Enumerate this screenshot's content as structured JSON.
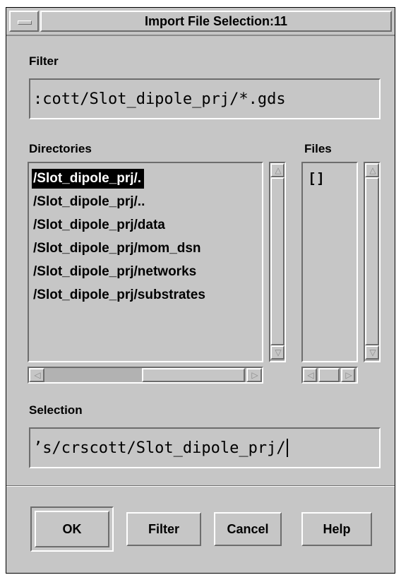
{
  "window": {
    "title": "Import File Selection:11"
  },
  "filter": {
    "label": "Filter",
    "value": ":cott/Slot_dipole_prj/*.gds"
  },
  "directories": {
    "label": "Directories",
    "items": [
      {
        "text": "/Slot_dipole_prj/.",
        "selected": true
      },
      {
        "text": "/Slot_dipole_prj/..",
        "selected": false
      },
      {
        "text": "/Slot_dipole_prj/data",
        "selected": false
      },
      {
        "text": "/Slot_dipole_prj/mom_dsn",
        "selected": false
      },
      {
        "text": "/Slot_dipole_prj/networks",
        "selected": false
      },
      {
        "text": "/Slot_dipole_prj/substrates",
        "selected": false
      }
    ]
  },
  "files": {
    "label": "Files",
    "items": [
      {
        "text": "[ ]"
      }
    ]
  },
  "selection": {
    "label": "Selection",
    "value": "’s/crscott/Slot_dipole_prj/"
  },
  "buttons": {
    "ok": "OK",
    "filter": "Filter",
    "cancel": "Cancel",
    "help": "Help"
  },
  "icons": {
    "scroll_up": "arrow-up-icon",
    "scroll_down": "arrow-down-icon",
    "scroll_left": "arrow-left-icon",
    "scroll_right": "arrow-right-icon",
    "window_menu": "window-menu-icon"
  },
  "colors": {
    "background": "#c6c6c6",
    "selected_bg": "#000000",
    "selected_fg": "#ffffff"
  }
}
